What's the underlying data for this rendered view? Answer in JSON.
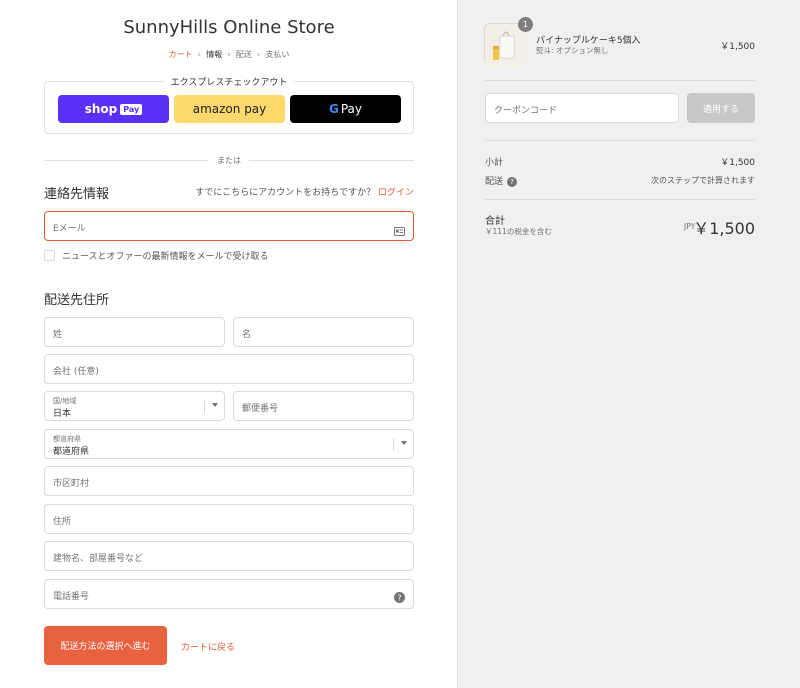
{
  "store": {
    "title": "SunnyHills Online Store"
  },
  "breadcrumb": [
    {
      "label": "カート",
      "state": "link"
    },
    {
      "label": "情報",
      "state": "current"
    },
    {
      "label": "配送",
      "state": "pending"
    },
    {
      "label": "支払い",
      "state": "pending"
    }
  ],
  "express": {
    "legend": "エクスプレスチェックアウト",
    "shop_pay": {
      "label": "shop",
      "chip": "Pay",
      "color": "#5a31f4"
    },
    "amazon_pay": {
      "label": "amazon pay",
      "color": "#fcd86d"
    },
    "google_pay": {
      "g": "G",
      "label": "Pay",
      "color": "#000000"
    }
  },
  "divider": {
    "text": "または"
  },
  "contact": {
    "title": "連絡先情報",
    "account_prompt": "すでにこちらにアカウントをお持ちですか？",
    "login_link": "ログイン",
    "email_placeholder": "Eメール",
    "newsletter_label": "ニュースとオファーの最新情報をメールで受け取る",
    "newsletter_checked": false
  },
  "shipping": {
    "title": "配送先住所",
    "last_name_placeholder": "姓",
    "first_name_placeholder": "名",
    "company_placeholder": "会社 (任意)",
    "country_label": "国/地域",
    "country_value": "日本",
    "postal_placeholder": "郵便番号",
    "prefecture_label": "都道府県",
    "prefecture_value": "都道府県",
    "city_placeholder": "市区町村",
    "address_placeholder": "住所",
    "building_placeholder": "建物名、部屋番号など",
    "phone_placeholder": "電話番号"
  },
  "actions": {
    "continue_label": "配送方法の選択へ進む",
    "back_label": "カートに戻る"
  },
  "order": {
    "item": {
      "name": "パイナップルケーキ5個入",
      "variant": "熨斗: オプション無し",
      "quantity": "1",
      "price": "￥1,500"
    },
    "coupon_placeholder": "クーポンコード",
    "apply_label": "適用する",
    "subtotal_label": "小計",
    "subtotal_value": "￥1,500",
    "shipping_label": "配送",
    "shipping_value": "次のステップで計算されます",
    "total_label": "合計",
    "tax_note": "￥111の税金を含む",
    "currency": "JPY",
    "total_value": "￥1,500"
  },
  "colors": {
    "accent": "#e05a33",
    "button_primary": "#e86240",
    "sidebar_bg": "#f0f0f0"
  }
}
